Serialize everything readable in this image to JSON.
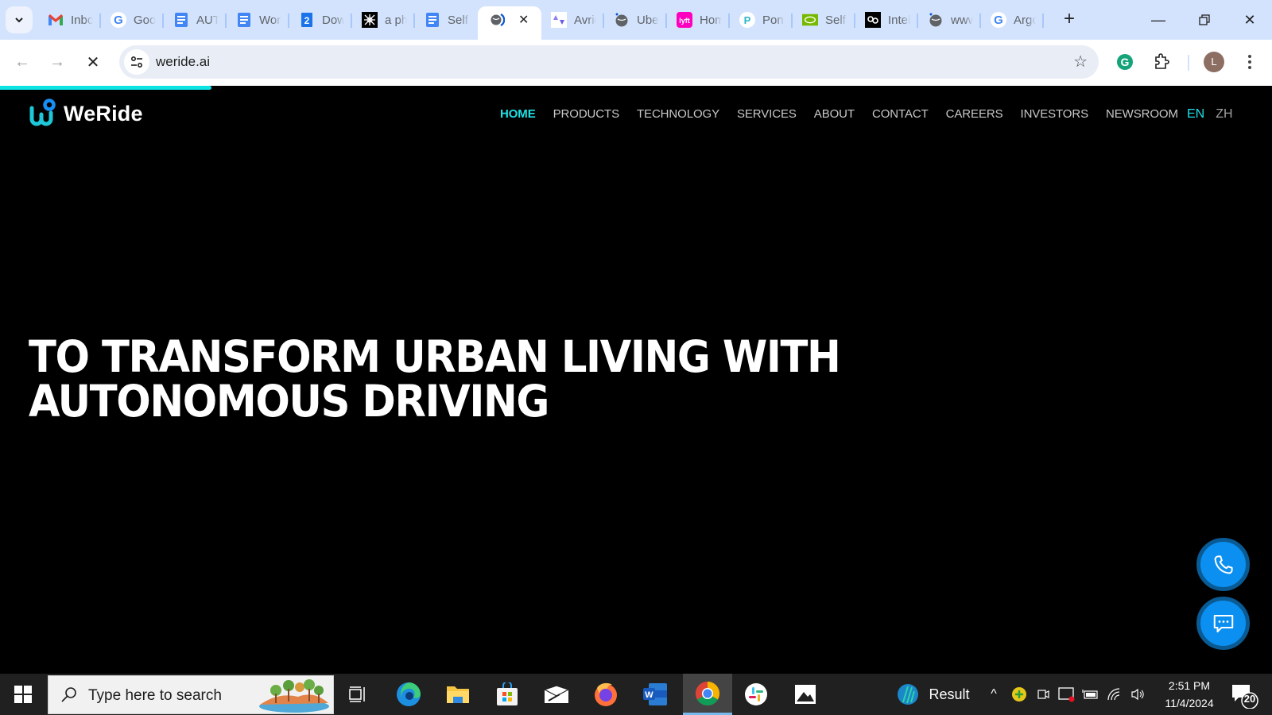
{
  "browser": {
    "tabs": [
      {
        "title": "Inbox",
        "icon": "gmail-icon"
      },
      {
        "title": "Google",
        "icon": "google-icon"
      },
      {
        "title": "AUTONOMOUS",
        "icon": "google-docs-icon"
      },
      {
        "title": "Word",
        "icon": "google-docs-icon"
      },
      {
        "title": "Download",
        "icon": "number-2-icon"
      },
      {
        "title": "a photo",
        "icon": "robot-icon"
      },
      {
        "title": "Self",
        "icon": "google-docs-icon"
      },
      {
        "title": "",
        "icon": "loading-globe-icon",
        "active": true
      },
      {
        "title": "Avride",
        "icon": "avride-icon"
      },
      {
        "title": "Uber",
        "icon": "globe-icon"
      },
      {
        "title": "Home",
        "icon": "lyft-icon"
      },
      {
        "title": "Pony",
        "icon": "pony-icon"
      },
      {
        "title": "Self",
        "icon": "nvidia-icon"
      },
      {
        "title": "Intel",
        "icon": "mobileye-icon"
      },
      {
        "title": "www",
        "icon": "globe-icon"
      },
      {
        "title": "Argo",
        "icon": "google-icon"
      }
    ],
    "close_tab_glyph": "✕",
    "new_tab_glyph": "+",
    "url": "weride.ai",
    "avatar_initial": "L",
    "load_progress_percent": 16.6
  },
  "site": {
    "logo_text": "WeRide",
    "nav": [
      {
        "label": "HOME",
        "active": true
      },
      {
        "label": "PRODUCTS"
      },
      {
        "label": "TECHNOLOGY"
      },
      {
        "label": "SERVICES"
      },
      {
        "label": "ABOUT"
      },
      {
        "label": "CONTACT"
      },
      {
        "label": "CAREERS"
      },
      {
        "label": "INVESTORS"
      },
      {
        "label": "NEWSROOM"
      }
    ],
    "languages": [
      {
        "label": "EN",
        "active": true
      },
      {
        "label": "ZH"
      }
    ],
    "hero": {
      "line1": "TO TRANSFORM URBAN LIVING WITH",
      "line2": "AUTONOMOUS DRIVING"
    },
    "colors": {
      "accent": "#1ee0e6",
      "fab": "#0b8ff0",
      "fab_border": "#0a5a93",
      "background": "#000000"
    }
  },
  "taskbar": {
    "search_placeholder": "Type here to search",
    "apps": [
      "task-view",
      "edge",
      "file-explorer",
      "microsoft-store",
      "mail",
      "firefox",
      "word",
      "chrome",
      "slack",
      "photos"
    ],
    "active_app": "chrome",
    "widget_label": "Result",
    "time": "2:51 PM",
    "date": "11/4/2024",
    "notification_count": "20"
  }
}
